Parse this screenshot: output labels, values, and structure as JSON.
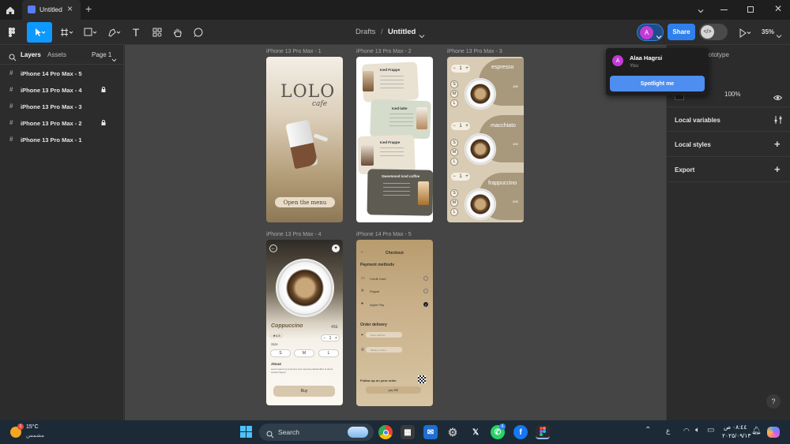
{
  "titlebar": {
    "tab_title": "Untitled",
    "close_glyph": "×",
    "newtab_glyph": "+"
  },
  "toolbar": {
    "breadcrumb_parent": "Drafts",
    "breadcrumb_sep": "/",
    "file_name": "Untitled",
    "share_label": "Share",
    "zoom_label": "35%",
    "avatar_letter": "A"
  },
  "leftpanel": {
    "tab_layers": "Layers",
    "tab_assets": "Assets",
    "page_label": "Page 1",
    "layers": [
      {
        "label": "iPhone 14 Pro Max - 5",
        "locked": false
      },
      {
        "label": "iPhone 13 Pro Max - 4",
        "locked": true
      },
      {
        "label": "iPhone 13 Pro Max - 3",
        "locked": false
      },
      {
        "label": "iPhone 13 Pro Max - 2",
        "locked": true
      },
      {
        "label": "iPhone 13 Pro Max - 1",
        "locked": false
      }
    ]
  },
  "canvas": {
    "frame_labels": {
      "f1": "iPhone 13 Pro Max - 1",
      "f2": "iPhone 13 Pro Max - 2",
      "f3": "iPhone 13 Pro Max - 3",
      "f4": "iPhone 13 Pro Max - 4",
      "f5": "iPhone 14 Pro Max - 5"
    },
    "f1": {
      "logo": "LOLO",
      "logo_sub": "cafe",
      "cta": "Open the menu"
    },
    "f2": {
      "items": [
        "Iced Frappe",
        "Iced latte",
        "Iced Frappe",
        "Sweetened Iced coffee"
      ]
    },
    "f3": {
      "items": [
        {
          "name": "espresso",
          "price": "45E"
        },
        {
          "name": "macchiato",
          "price": "40E"
        },
        {
          "name": "frappuccino",
          "price": "50E"
        }
      ],
      "qty": "1",
      "sizes": [
        "S",
        "M",
        "L"
      ]
    },
    "f4": {
      "title": "Coppuccino",
      "price": "45E",
      "rating": "4.8",
      "qty": "1",
      "size_label": "Size",
      "sizes": [
        "S",
        "M",
        "L"
      ],
      "about_label": "About",
      "about_text": "Lorem ipsum is a dummy text used as placeholder to show content layout",
      "buy": "Buy"
    },
    "f5": {
      "title": "Checkout",
      "payment_label": "Payment methods",
      "methods": [
        "Credit Card",
        "Paypal",
        "Apple Pay"
      ],
      "delivery_label": "Order delivery",
      "delivery_fields": [
        "Enter address",
        "Mobile number"
      ],
      "follow_label": "Follow up on your order",
      "pay_btn": "pay 95E"
    }
  },
  "popover": {
    "user_name": "Alaa Hagrsi",
    "user_sub": "You",
    "spotlight": "Spotlight me",
    "avatar_letter": "A"
  },
  "rightpanel": {
    "tab_behind": "rototype",
    "opacity": "100%",
    "local_variables": "Local variables",
    "local_styles": "Local styles",
    "export": "Export",
    "help": "?"
  },
  "taskbar": {
    "weather_temp": "15°C",
    "weather_desc": "مشمس",
    "search": "Search",
    "lang": "ع",
    "time": "٠٨:٤٤ ص",
    "date": "٢٠٢٥/٠٩/١٣",
    "badge": "1"
  },
  "colors": {
    "accent": "#0d99ff",
    "share": "#2f80ed",
    "spotlight": "#4d8ef0",
    "avatar": "#c33bd6"
  }
}
